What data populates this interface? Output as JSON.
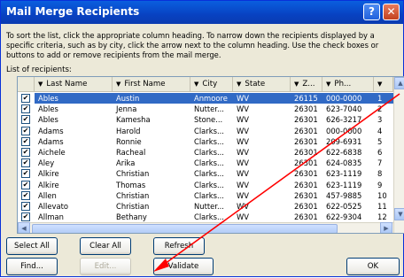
{
  "window": {
    "title": "Mail Merge Recipients",
    "help_label": "?",
    "close_label": "✕"
  },
  "instructions": "To sort the list, click the appropriate column heading. To narrow down the recipients displayed by a specific criteria, such as by city, click the arrow next to the column heading. Use the check boxes or buttons to add or remove recipients from the mail merge.",
  "list_label": "List of recipients:",
  "columns": [
    "Last Name",
    "First Name",
    "City",
    "State",
    "Z...",
    "Ph...",
    ""
  ],
  "rows": [
    [
      "Ables",
      "Austin",
      "Anmoore",
      "WV",
      "26115",
      "000-0000",
      "1"
    ],
    [
      "Ables",
      "Jenna",
      "Nutter...",
      "WV",
      "26301",
      "623-7040",
      "2"
    ],
    [
      "Ables",
      "Kamesha",
      "Stone...",
      "WV",
      "26301",
      "626-3217",
      "3"
    ],
    [
      "Adams",
      "Harold",
      "Clarks...",
      "WV",
      "26301",
      "000-0000",
      "4"
    ],
    [
      "Adams",
      "Ronnie",
      "Clarks...",
      "WV",
      "26301",
      "209-6931",
      "5"
    ],
    [
      "Aichele",
      "Racheal",
      "Clarks...",
      "WV",
      "26301",
      "622-6838",
      "6"
    ],
    [
      "Aley",
      "Arika",
      "Clarks...",
      "WV",
      "26301",
      "624-0835",
      "7"
    ],
    [
      "Alkire",
      "Christian",
      "Clarks...",
      "WV",
      "26301",
      "623-1119",
      "8"
    ],
    [
      "Alkire",
      "Thomas",
      "Clarks...",
      "WV",
      "26301",
      "623-1119",
      "9"
    ],
    [
      "Allen",
      "Christian",
      "Clarks...",
      "WV",
      "26301",
      "457-9885",
      "10"
    ],
    [
      "Allevato",
      "Christian",
      "Nutter...",
      "WV",
      "26301",
      "622-0525",
      "11"
    ],
    [
      "Allman",
      "Bethany",
      "Clarks...",
      "WV",
      "26301",
      "622-9304",
      "12"
    ]
  ],
  "selected_row": 0,
  "buttons": {
    "select_all": "Select All",
    "clear_all": "Clear All",
    "refresh": "Refresh",
    "find": "Find...",
    "edit": "Edit...",
    "validate": "Validate",
    "ok": "OK"
  },
  "colors": {
    "title_blue": "#0842c2",
    "selection": "#316ac5",
    "annotation_arrow": "#ff0000"
  }
}
